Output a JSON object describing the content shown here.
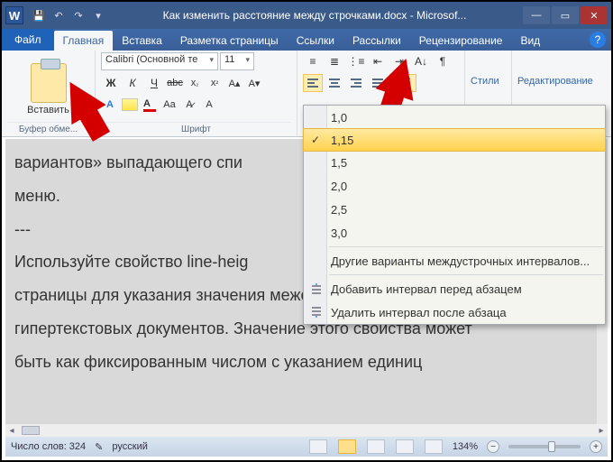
{
  "titlebar": {
    "app_icon_letter": "W",
    "doc_title": "Как изменить расстояние между строчками.docx - Microsof..."
  },
  "tabs": {
    "file": "Файл",
    "home": "Главная",
    "insert": "Вставка",
    "layout": "Разметка страницы",
    "refs": "Ссылки",
    "mail": "Рассылки",
    "review": "Рецензирование",
    "view": "Вид"
  },
  "ribbon": {
    "clipboard": {
      "paste": "Вставить",
      "group": "Буфер обме..."
    },
    "font": {
      "name": "Calibri (Основной те",
      "size": "11",
      "group": "Шрифт"
    },
    "styles": "Стили",
    "editing": "Редактирование"
  },
  "menu": {
    "opt1": "1,0",
    "opt2": "1,15",
    "opt3": "1,5",
    "opt4": "2,0",
    "opt5": "2,5",
    "opt6": "3,0",
    "more": "Другие варианты междустрочных интервалов...",
    "before": "Добавить интервал перед абзацем",
    "after": "Удалить интервал после абзаца"
  },
  "document": {
    "line1": "вариантов» выпадающего спи",
    "line2": "меню.",
    "line3": "---",
    "line4": "Используйте свойство line-heig",
    "line5": "страницы для указания значения межстрочного интервала",
    "line6": "гипертекстовых документов. Значение этого свойства может",
    "line7": "быть как фиксированным числом с указанием единиц"
  },
  "status": {
    "words": "Число слов: 324",
    "lang": "русский",
    "zoom": "134%"
  }
}
